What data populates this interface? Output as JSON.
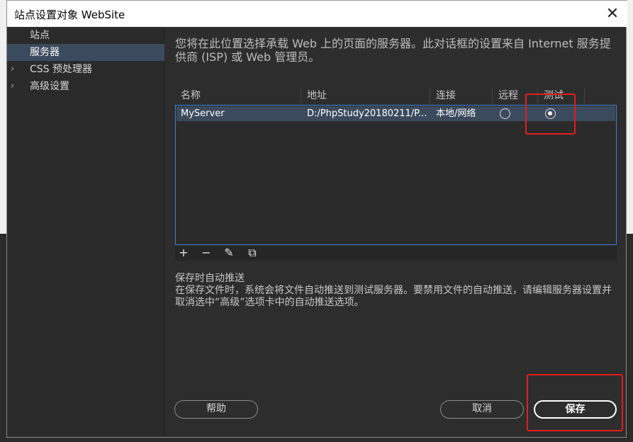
{
  "window": {
    "title": "站点设置对象 WebSite",
    "close_glyph": "✕"
  },
  "sidebar": {
    "items": [
      {
        "label": "站点",
        "chevron": ""
      },
      {
        "label": "服务器",
        "chevron": ""
      },
      {
        "label": "CSS 预处理器",
        "chevron": "›"
      },
      {
        "label": "高级设置",
        "chevron": "›"
      }
    ],
    "active_index": 1
  },
  "main": {
    "description": "您将在此位置选择承载 Web 上的页面的服务器。此对话框的设置来自 Internet 服务提供商 (ISP) 或 Web 管理员。",
    "table": {
      "columns": [
        "名称",
        "地址",
        "连接",
        "远程",
        "测试"
      ],
      "rows": [
        {
          "name": "MyServer",
          "address": "D:/PhpStudy20180211/P...",
          "connection": "本地/网络",
          "remote": false,
          "test": true
        }
      ]
    },
    "toolbar": {
      "add": "+",
      "remove": "−",
      "edit": "✎",
      "duplicate": "⧉"
    },
    "auto_push": {
      "title": "保存时自动推送",
      "description": "在保存文件时，系统会将文件自动推送到测试服务器。要禁用文件的自动推送，请编辑服务器设置并取消选中“高级”选项卡中的自动推送选项。"
    }
  },
  "buttons": {
    "help": "帮助",
    "cancel": "取消",
    "save": "保存"
  },
  "colors": {
    "selection": "#3b4a5d",
    "table_border": "#3c7fd1",
    "highlight": "#e31c1c",
    "dialog_bg": "#2d2d2d"
  },
  "icons": {
    "close": "close-icon",
    "add": "plus-icon",
    "remove": "minus-icon",
    "edit": "pencil-icon",
    "duplicate": "duplicate-icon",
    "expand": "chevron-right-icon"
  }
}
